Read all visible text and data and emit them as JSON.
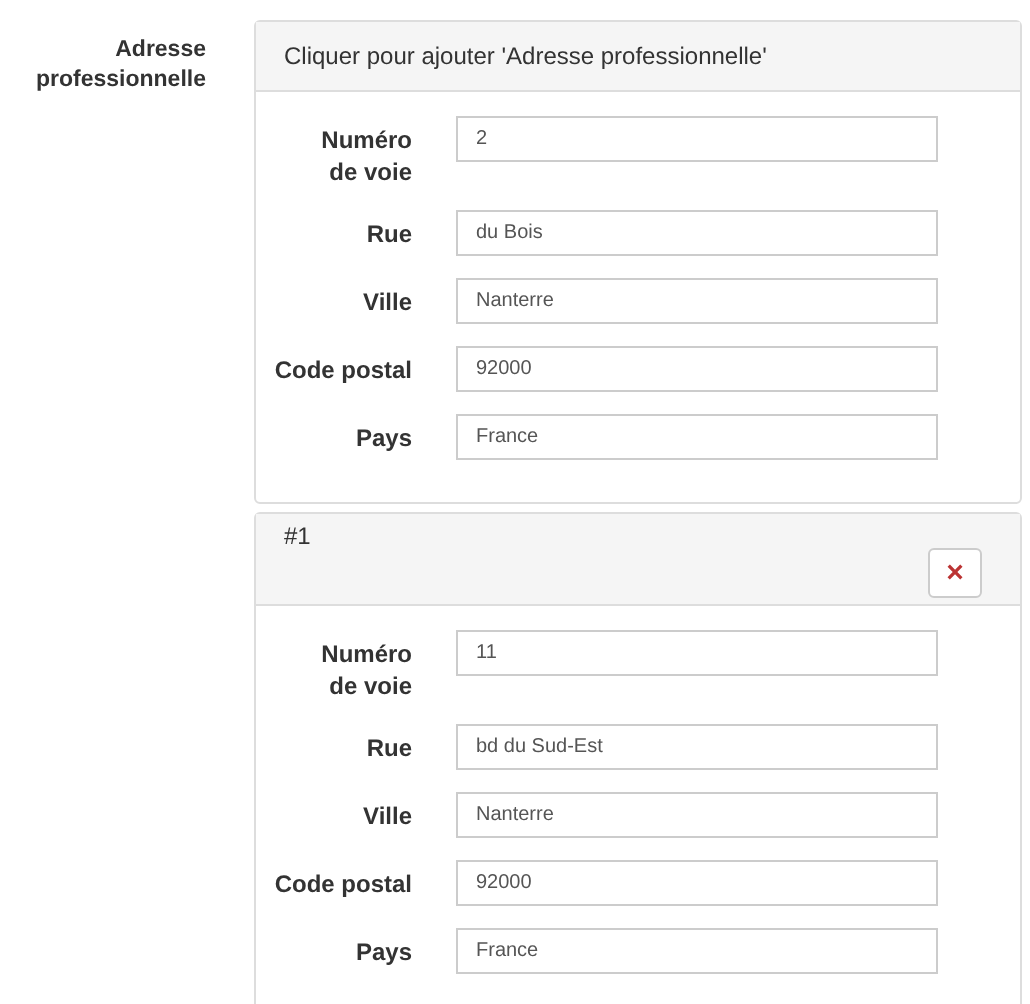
{
  "field_label": "Adresse professionnelle",
  "panels": [
    {
      "kind": "add",
      "title": "Cliquer pour ajouter 'Adresse professionnelle'",
      "fields": [
        {
          "label": "Numéro de voie",
          "value": "2"
        },
        {
          "label": "Rue",
          "value": "du Bois"
        },
        {
          "label": "Ville",
          "value": "Nanterre"
        },
        {
          "label": "Code postal",
          "value": "92000"
        },
        {
          "label": "Pays",
          "value": "France"
        }
      ]
    },
    {
      "kind": "entry",
      "title": "#1",
      "remove_button": "×",
      "fields": [
        {
          "label": "Numéro de voie",
          "value": "11"
        },
        {
          "label": "Rue",
          "value": "bd du Sud-Est"
        },
        {
          "label": "Ville",
          "value": "Nanterre"
        },
        {
          "label": "Code postal",
          "value": "92000"
        },
        {
          "label": "Pays",
          "value": "France"
        }
      ]
    }
  ]
}
